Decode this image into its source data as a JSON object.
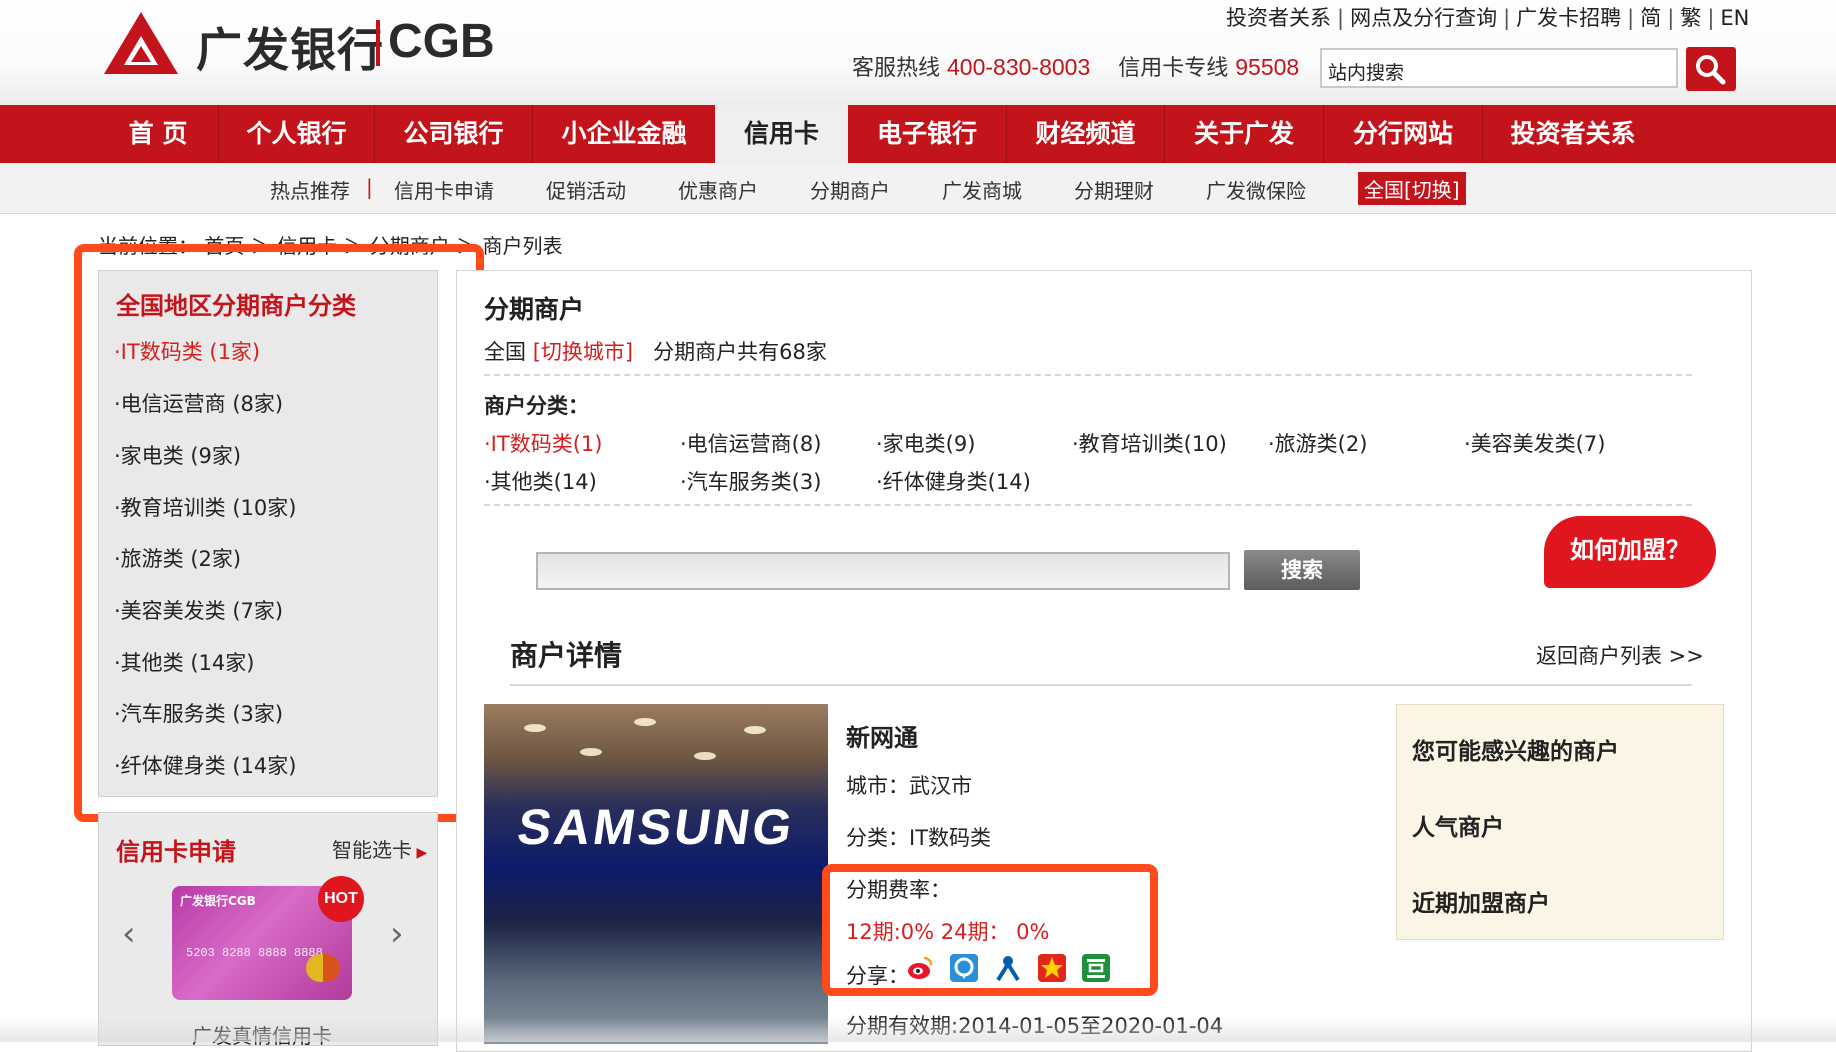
{
  "header": {
    "logo_text": "广发银行",
    "logo_cgb": "CGB",
    "top_links": [
      "投资者关系",
      "网点及分行查询",
      "广发卡招聘",
      "简",
      "繁",
      "EN"
    ],
    "hotline_label": "客服热线",
    "hotline_number": "400-830-8003",
    "cc_line_label": "信用卡专线",
    "cc_line_number": "95508",
    "search_placeholder": "站内搜索"
  },
  "main_nav": {
    "items": [
      "首 页",
      "个人银行",
      "公司银行",
      "小企业金融",
      "信用卡",
      "电子银行",
      "财经频道",
      "关于广发",
      "分行网站",
      "投资者关系"
    ],
    "active": "信用卡"
  },
  "sub_nav": {
    "items": [
      "热点推荐",
      "信用卡申请",
      "促销活动",
      "优惠商户",
      "分期商户",
      "广发商城",
      "分期理财",
      "广发微保险"
    ],
    "switch_label": "全国[切换]"
  },
  "breadcrumb": "当前位置： 首页 ＞ 信用卡 ＞ 分期商户 ＞ 商户列表",
  "left_panel": {
    "title": "全国地区分期商户分类",
    "items": [
      "·IT数码类 (1家)",
      "·电信运营商 (8家)",
      "·家电类 (9家)",
      "·教育培训类 (10家)",
      "·旅游类 (2家)",
      "·美容美发类 (7家)",
      "·其他类 (14家)",
      "·汽车服务类 (3家)",
      "·纤体健身类 (14家)"
    ]
  },
  "credit_card_panel": {
    "title": "信用卡申请",
    "smart_select": "智能选卡",
    "card_name": "广发真情信用卡",
    "card_bank_label": "广发银行CGB",
    "hot_badge": "HOT",
    "card_number": "5203 8288 8888 8888"
  },
  "main": {
    "title": "分期商户",
    "region": "全国",
    "switch_city": "[切换城市]",
    "count_text": "分期商户共有68家",
    "category_label": "商户分类：",
    "categories": [
      "·IT数码类(1)",
      "·电信运营商(8)",
      "·家电类(9)",
      "·教育培训类(10)",
      "·旅游类(2)",
      "·美容美发类(7)",
      "·其他类(14)",
      "·汽车服务类(3)",
      "·纤体健身类(14)"
    ],
    "search_button": "搜索",
    "join_button": "如何加盟？"
  },
  "detail": {
    "title": "商户详情",
    "back_link": "返回商户列表 >>",
    "photo_brand": "SAMSUNG",
    "merchant_name": "新网通",
    "city": "城市：武汉市",
    "category": "分类：IT数码类",
    "rate_label": "分期费率：",
    "rate_value": "12期:0% 24期： 0%",
    "share_label": "分享：",
    "share_icons": [
      "weibo-icon",
      "qzone-icon",
      "renren-icon",
      "kaixin-icon",
      "douban-icon"
    ],
    "valid_period": "分期有效期:2014-01-05至2020-01-04"
  },
  "right_box": {
    "items": [
      "您可能感兴趣的商户",
      "人气商户",
      "近期加盟商户"
    ]
  },
  "colors": {
    "brand_red": "#c4141b",
    "highlight_red": "#d61f1f",
    "annotation_orange": "#ff4a1c"
  }
}
